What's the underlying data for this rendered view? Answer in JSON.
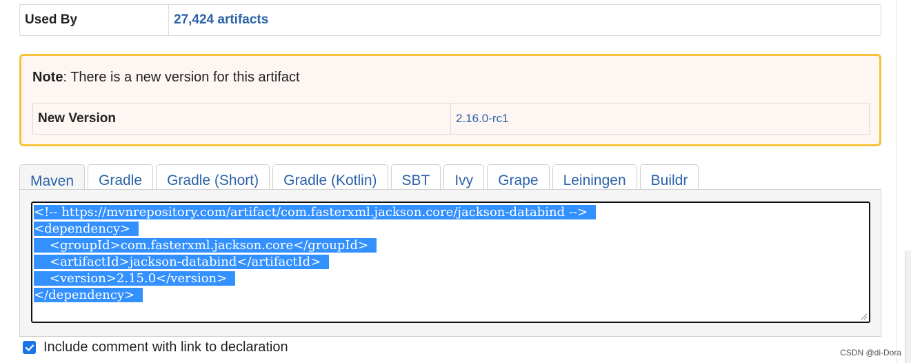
{
  "used_by": {
    "label": "Used By",
    "value": "27,424 artifacts"
  },
  "note": {
    "prefix": "Note",
    "text": ": There is a new version for this artifact",
    "new_version_label": "New Version",
    "new_version_value": "2.16.0-rc1",
    "border_color": "#f5c33b"
  },
  "tabs": [
    {
      "label": "Maven",
      "active": true
    },
    {
      "label": "Gradle"
    },
    {
      "label": "Gradle (Short)"
    },
    {
      "label": "Gradle (Kotlin)"
    },
    {
      "label": "SBT"
    },
    {
      "label": "Ivy"
    },
    {
      "label": "Grape"
    },
    {
      "label": "Leiningen"
    },
    {
      "label": "Buildr"
    }
  ],
  "code": {
    "lines": [
      "<!-- https://mvnrepository.com/artifact/com.fasterxml.jackson.core/jackson-databind -->",
      "<dependency>",
      "    <groupId>com.fasterxml.jackson.core</groupId>",
      "    <artifactId>jackson-databind</artifactId>",
      "    <version>2.15.0</version>",
      "</dependency>"
    ],
    "selection_color": "#3390ff"
  },
  "checkbox": {
    "label": "Include comment with link to declaration",
    "checked": true
  },
  "watermark": "CSDN @di-Dora",
  "colors": {
    "link": "#2a62a8",
    "checkbox": "#1a73e8"
  }
}
